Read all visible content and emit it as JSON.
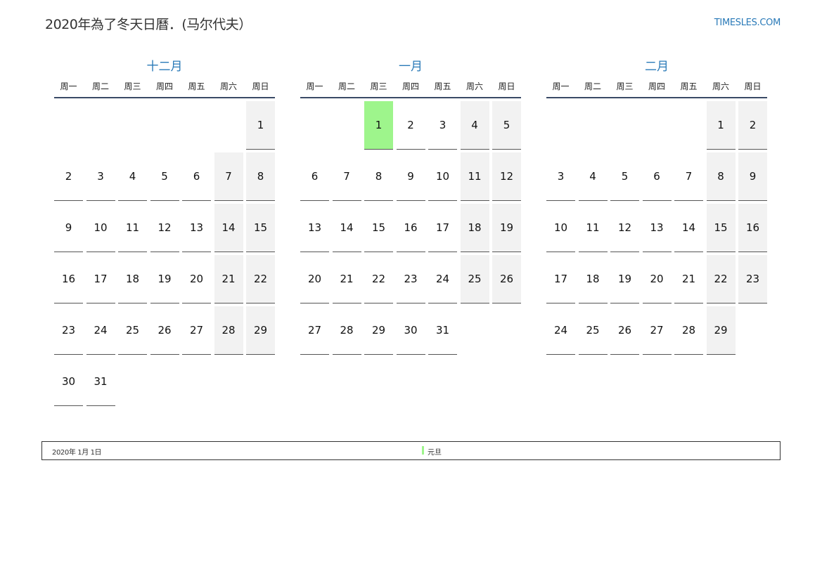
{
  "header": {
    "title": "2020年為了冬天日曆．(马尔代夫）",
    "site": "TIMESLES.COM"
  },
  "weekdays": [
    "周一",
    "周二",
    "周三",
    "周四",
    "周五",
    "周六",
    "周日"
  ],
  "colors": {
    "accent": "#2a7ab8",
    "weekend": "#f2f2f2",
    "holiday": "#9ef58c"
  },
  "months": [
    {
      "name": "十二月",
      "weeks": [
        [
          "",
          "",
          "",
          "",
          "",
          "",
          "1"
        ],
        [
          "2",
          "3",
          "4",
          "5",
          "6",
          "7",
          "8"
        ],
        [
          "9",
          "10",
          "11",
          "12",
          "13",
          "14",
          "15"
        ],
        [
          "16",
          "17",
          "18",
          "19",
          "20",
          "21",
          "22"
        ],
        [
          "23",
          "24",
          "25",
          "26",
          "27",
          "28",
          "29"
        ],
        [
          "30",
          "31",
          "",
          "",
          "",
          "",
          ""
        ]
      ],
      "holidays": []
    },
    {
      "name": "一月",
      "weeks": [
        [
          "",
          "",
          "1",
          "2",
          "3",
          "4",
          "5"
        ],
        [
          "6",
          "7",
          "8",
          "9",
          "10",
          "11",
          "12"
        ],
        [
          "13",
          "14",
          "15",
          "16",
          "17",
          "18",
          "19"
        ],
        [
          "20",
          "21",
          "22",
          "23",
          "24",
          "25",
          "26"
        ],
        [
          "27",
          "28",
          "29",
          "30",
          "31",
          "",
          ""
        ]
      ],
      "holidays": [
        "1"
      ]
    },
    {
      "name": "二月",
      "weeks": [
        [
          "",
          "",
          "",
          "",
          "",
          "1",
          "2"
        ],
        [
          "3",
          "4",
          "5",
          "6",
          "7",
          "8",
          "9"
        ],
        [
          "10",
          "11",
          "12",
          "13",
          "14",
          "15",
          "16"
        ],
        [
          "17",
          "18",
          "19",
          "20",
          "21",
          "22",
          "23"
        ],
        [
          "24",
          "25",
          "26",
          "27",
          "28",
          "29",
          ""
        ]
      ],
      "holidays": []
    }
  ],
  "holiday_list": [
    {
      "date": "2020年 1月 1日",
      "name": "元旦"
    }
  ]
}
